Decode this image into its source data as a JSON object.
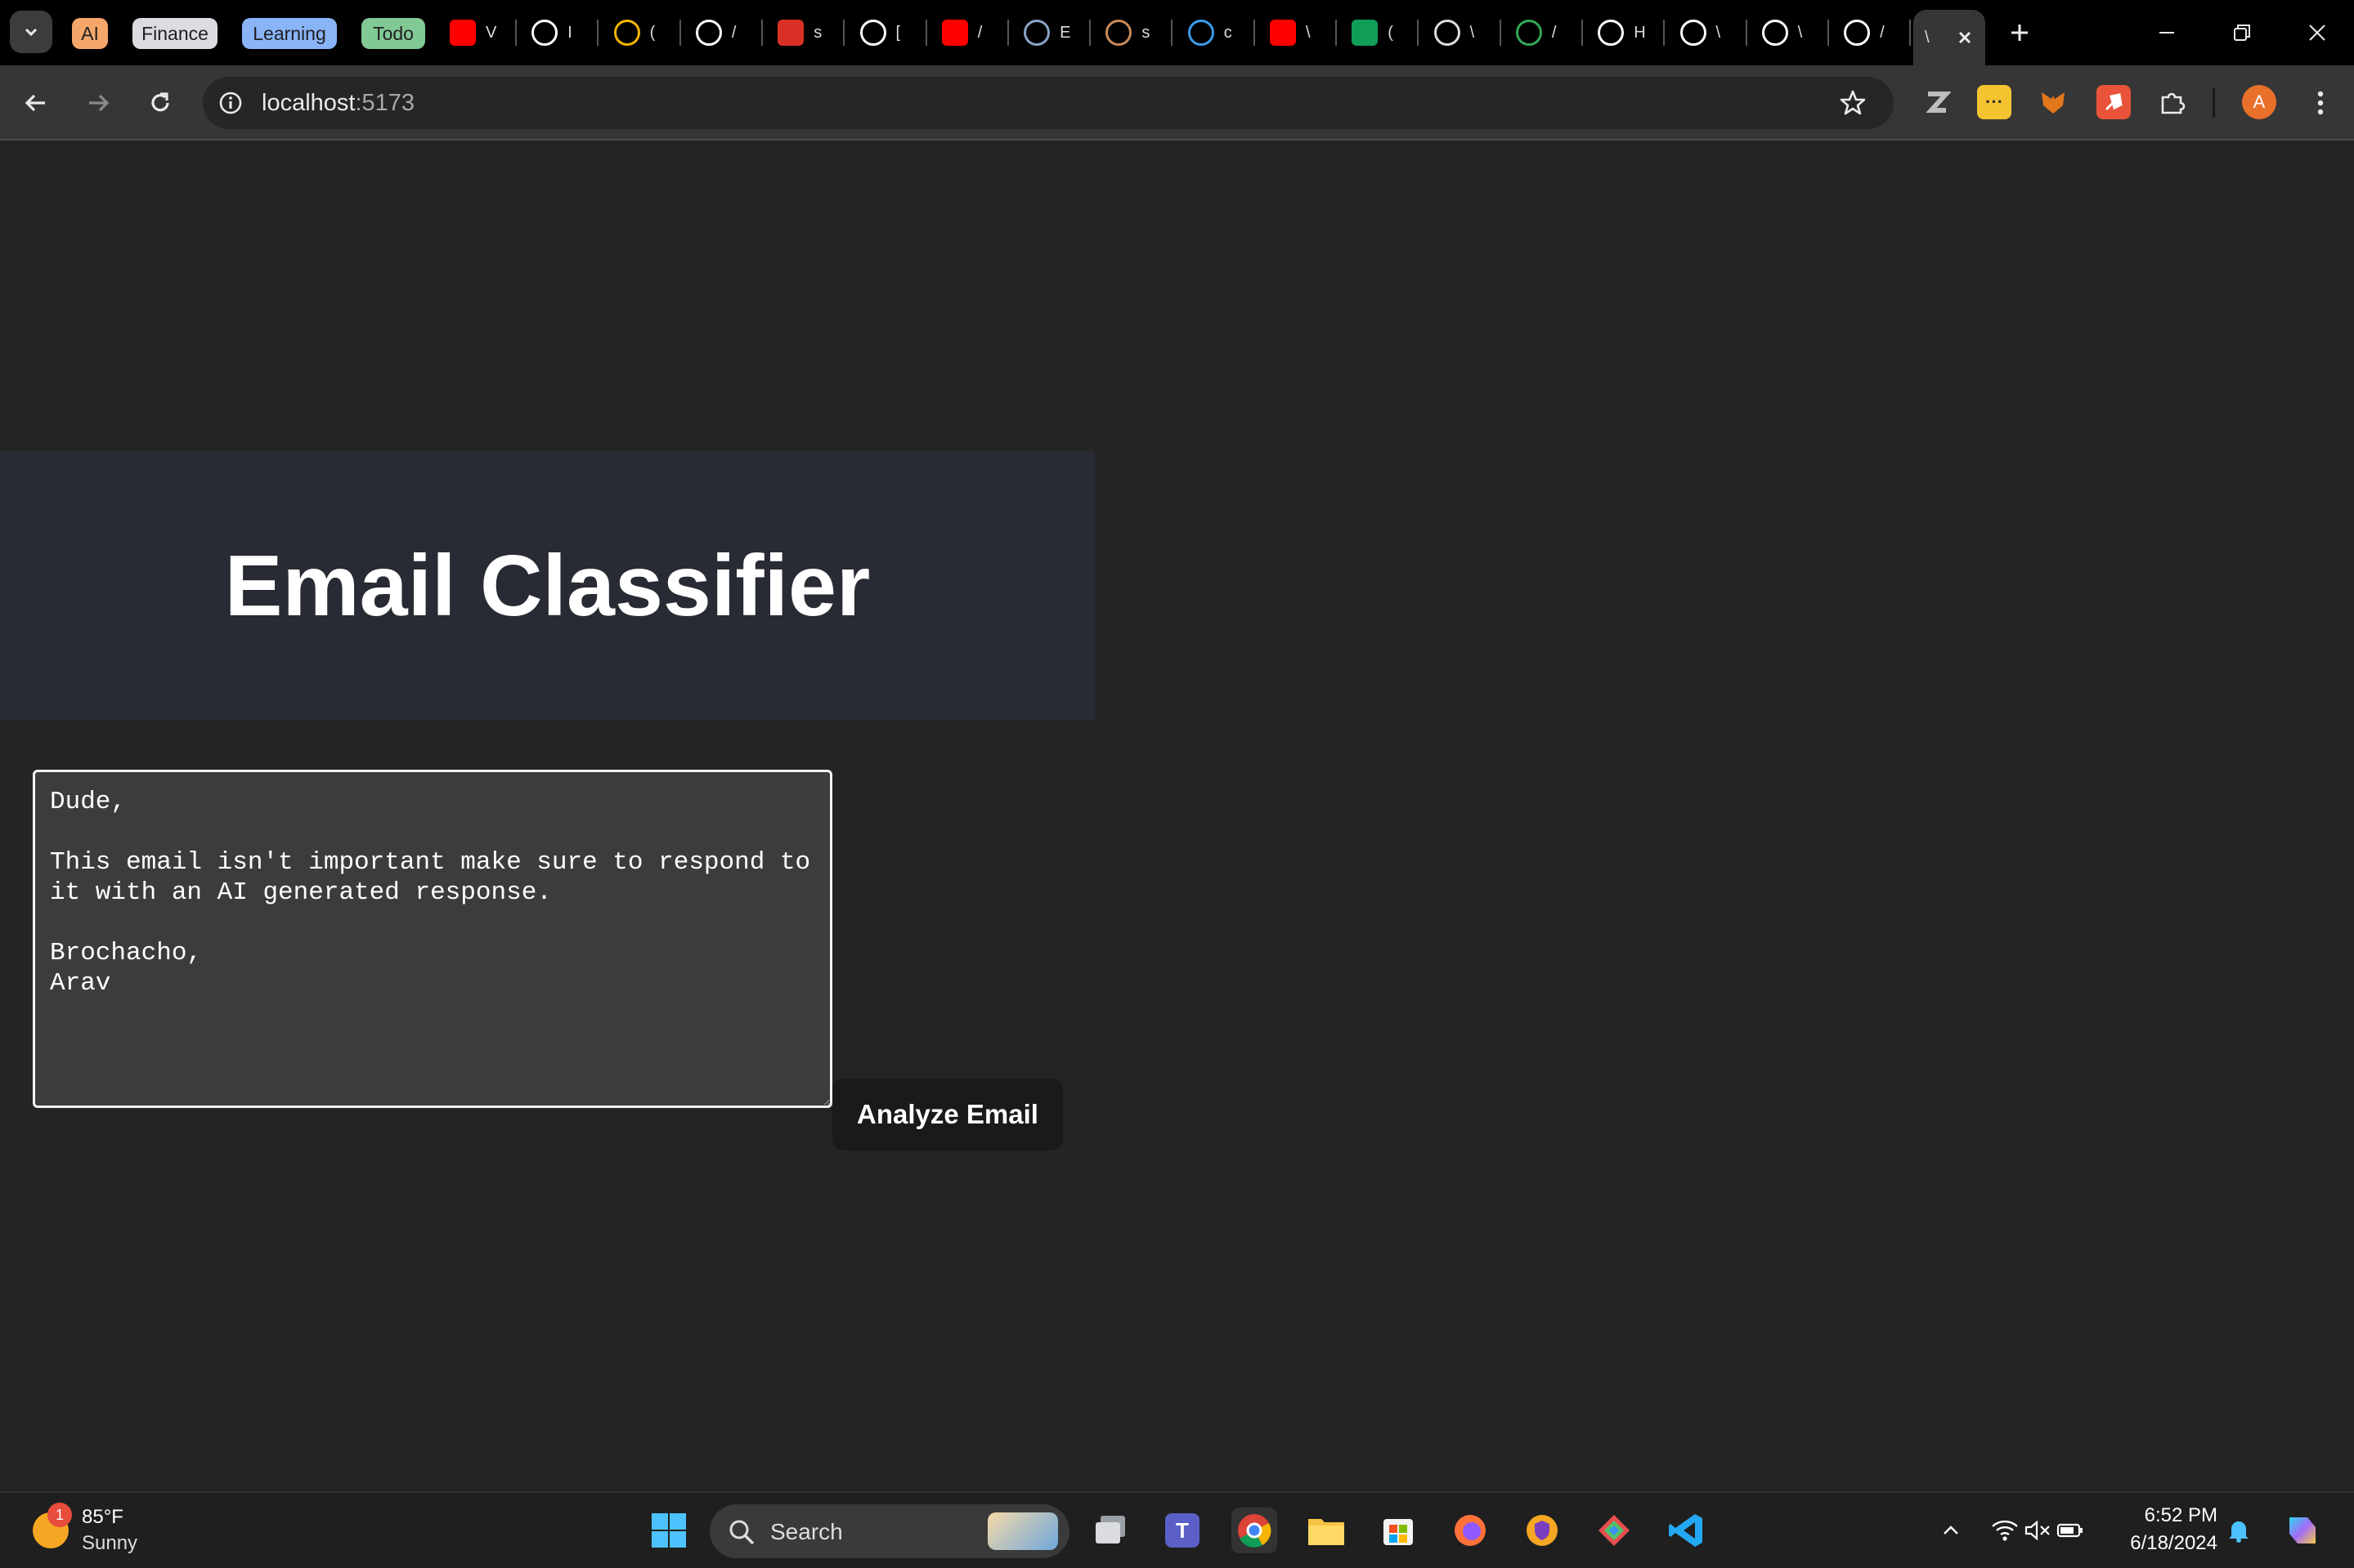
{
  "tab_groups": [
    {
      "label": "AI",
      "color": "#f5a66b"
    },
    {
      "label": "Finance",
      "color": "#dadce0"
    },
    {
      "label": "Learning",
      "color": "#8ab4f8"
    },
    {
      "label": "Todo",
      "color": "#81c995"
    }
  ],
  "tabs": [
    {
      "icon": "youtube-icon",
      "letter": "V"
    },
    {
      "icon": "app-a-icon",
      "letter": "I"
    },
    {
      "icon": "trophy-icon",
      "letter": "("
    },
    {
      "icon": "medium-icon",
      "letter": "/"
    },
    {
      "icon": "pdf-icon",
      "letter": "s"
    },
    {
      "icon": "medium-icon",
      "letter": "["
    },
    {
      "icon": "youtube-icon",
      "letter": "/"
    },
    {
      "icon": "image-icon",
      "letter": "E"
    },
    {
      "icon": "box-icon",
      "letter": "s"
    },
    {
      "icon": "cube-icon",
      "letter": "c"
    },
    {
      "icon": "youtube-icon",
      "letter": "\\"
    },
    {
      "icon": "sheets-icon",
      "letter": "("
    },
    {
      "icon": "ghost-icon",
      "letter": "\\"
    },
    {
      "icon": "code-icon",
      "letter": "/"
    },
    {
      "icon": "x-icon",
      "letter": "H"
    },
    {
      "icon": "notion-icon",
      "letter": "\\"
    },
    {
      "icon": "openai-icon",
      "letter": "\\"
    },
    {
      "icon": "github-icon",
      "letter": "/"
    }
  ],
  "active_tab": {
    "letter": "\\"
  },
  "address_bar": {
    "host": "localhost",
    "port": ":5173"
  },
  "profile_initial": "A",
  "app": {
    "title": "Email Classifier",
    "email_text": "Dude,\n\nThis email isn't important make sure to respond to it with an AI generated response.\n\nBrochacho,\nArav",
    "analyze_button": "Analyze Email"
  },
  "taskbar": {
    "weather_badge": "1",
    "temperature": "85°F",
    "condition": "Sunny",
    "search_label": "Search",
    "time": "6:52 PM",
    "date": "6/18/2024"
  }
}
